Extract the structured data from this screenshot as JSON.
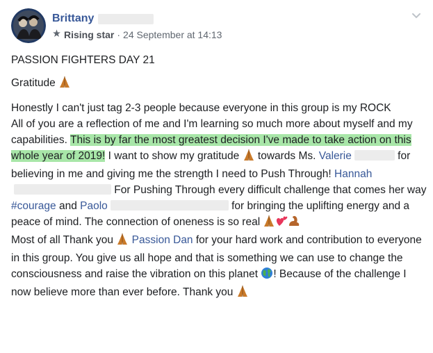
{
  "author": {
    "name": "Brittany"
  },
  "badge": {
    "label": "Rising star"
  },
  "timestamp": "24 September at 14:13",
  "meta_separator": "·",
  "post": {
    "title": "PASSION FIGHTERS DAY 21",
    "gratitude": "Gratitude",
    "p1": "Honestly I can't just tag 2-3 people because everyone in this group is my ROCK",
    "p2_a": "All of you are a reflection of me and I'm learning so much more about myself and my capabilities. ",
    "p2_highlight": "This is by far the most greatest decision I've made to take action on this whole year of 2019!",
    "p2_b": " I want to show my gratitude ",
    "p2_c": " towards Ms. ",
    "mention_valerie": "Valerie",
    "p2_d": " for believing in me and giving me the strength I need to Push Through! ",
    "mention_hannah": "Hannah",
    "p2_e": " For Pushing Through every difficult challenge that comes her way ",
    "hashtag": "#courage",
    "p2_f": " and ",
    "mention_paolo": "Paolo",
    "p2_g": " for bringing the uplifting energy and a peace of mind. The connection of oneness is so real ",
    "p3_a": "Most of all Thank you ",
    "mention_dan": "Passion Dan",
    "p3_b": " for your hard work and contribution to everyone in this group. You give us all hope and that is something we can use to change the consciousness and raise the vibration on this planet ",
    "p3_c": "! Because of the challenge I now believe more than ever before. Thank you "
  },
  "icons": {
    "badge": "star-badge-icon",
    "menu": "chevron-down-icon",
    "pray": "praying-hands-emoji",
    "heart": "two-hearts-emoji",
    "muscle": "flexed-bicep-emoji",
    "globe": "globe-emoji"
  },
  "colors": {
    "link": "#385898",
    "highlight": "#a8e6a8",
    "text": "#1c1e21",
    "meta": "#606770",
    "redaction": "#ececec"
  }
}
